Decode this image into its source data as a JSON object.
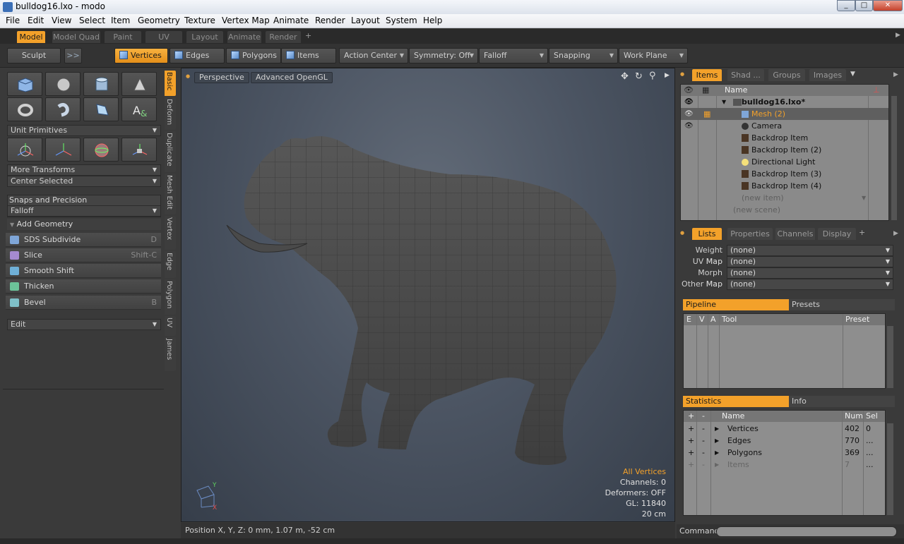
{
  "window": {
    "title": "bulldog16.lxo - modo",
    "minimize": "_",
    "maximize": "□",
    "close": "✕"
  },
  "menu": [
    "File",
    "Edit",
    "View",
    "Select",
    "Item",
    "Geometry",
    "Texture",
    "Vertex Map",
    "Animate",
    "Render",
    "Layout",
    "System",
    "Help"
  ],
  "layout_tabs": [
    {
      "label": "Model",
      "active": true
    },
    {
      "label": "Model Quad"
    },
    {
      "label": "Paint"
    },
    {
      "label": "UV"
    },
    {
      "label": "Layout"
    },
    {
      "label": "Animate"
    },
    {
      "label": "Render"
    }
  ],
  "layout_add": "+",
  "toolbar": {
    "sculpt": "Sculpt",
    "more": ">>",
    "modes": {
      "vertices": "Vertices",
      "edges": "Edges",
      "polygons": "Polygons",
      "items": "Items"
    },
    "action_center": "Action Center",
    "symmetry": "Symmetry: Off",
    "falloff": "Falloff",
    "snapping": "Snapping",
    "work_plane": "Work Plane"
  },
  "left": {
    "unit_primitives": "Unit Primitives",
    "more_transforms": "More Transforms",
    "center_selected": "Center Selected",
    "snaps": "Snaps and Precision",
    "falloff": "Falloff",
    "add_geometry": "Add Geometry",
    "tools": [
      {
        "label": "SDS Subdivide",
        "shortcut": "D",
        "icon": "sds-subdivide-icon",
        "color": "#7fa6d8"
      },
      {
        "label": "Slice",
        "shortcut": "Shift-C",
        "icon": "slice-icon",
        "color": "#a58ad0"
      },
      {
        "label": "Smooth Shift",
        "shortcut": "",
        "icon": "smooth-shift-icon",
        "color": "#6fb0d8"
      },
      {
        "label": "Thicken",
        "shortcut": "",
        "icon": "thicken-icon",
        "color": "#6cc49a"
      },
      {
        "label": "Bevel",
        "shortcut": "B",
        "icon": "bevel-icon",
        "color": "#7fc0c8"
      }
    ],
    "edit": "Edit",
    "vtabs": [
      "Basic",
      "Deform",
      "Duplicate",
      "Mesh Edit",
      "Vertex",
      "Edge",
      "Polygon",
      "UV",
      "James"
    ]
  },
  "viewport": {
    "view": "Perspective",
    "shading": "Advanced OpenGL",
    "hud": {
      "selection": "All Vertices",
      "channels": "Channels: 0",
      "deformers": "Deformers: OFF",
      "gl": "GL: 11840",
      "scale": "20 cm"
    },
    "status": "Position X, Y, Z:   0 mm, 1.07 m, -52 cm",
    "axis_y": "Y",
    "axis_x": "X"
  },
  "items_panel": {
    "tabs": [
      "Items",
      "Shad ...",
      "Groups",
      "Images"
    ],
    "name_header": "Name",
    "items": [
      "bulldog16.lxo*",
      "Mesh (2)",
      "Camera",
      "Backdrop Item",
      "Backdrop Item (2)",
      "Directional Light",
      "Backdrop Item (3)",
      "Backdrop Item (4)"
    ],
    "new_item": "(new item)",
    "new_scene": "(new scene)"
  },
  "lists_panel": {
    "tabs": [
      "Lists",
      "Properties",
      "Channels",
      "Display"
    ],
    "add": "+",
    "maps": [
      {
        "label": "Weight Map",
        "value": "(none)"
      },
      {
        "label": "UV Map",
        "value": "(none)"
      },
      {
        "label": "Morph Map",
        "value": "(none)"
      },
      {
        "label": "Other Map",
        "value": "(none)"
      }
    ]
  },
  "pipeline": {
    "tab": "Pipeline",
    "presets": "Presets",
    "headers": [
      "E",
      "V",
      "A",
      "Tool",
      "Preset"
    ]
  },
  "statistics": {
    "tab": "Statistics",
    "info": "Info",
    "headers": [
      "+",
      "-",
      "Name",
      "Num",
      "Sel"
    ],
    "rows": [
      {
        "plus": "+",
        "minus": "-",
        "name": "Vertices",
        "num": "402",
        "sel": "0"
      },
      {
        "plus": "+",
        "minus": "-",
        "name": "Edges",
        "num": "770",
        "sel": "..."
      },
      {
        "plus": "+",
        "minus": "-",
        "name": "Polygons",
        "num": "369",
        "sel": "..."
      },
      {
        "plus": "+",
        "minus": "-",
        "name": "Items",
        "num": "7",
        "sel": "..."
      }
    ]
  },
  "command": {
    "label": "Command",
    "value": ""
  }
}
